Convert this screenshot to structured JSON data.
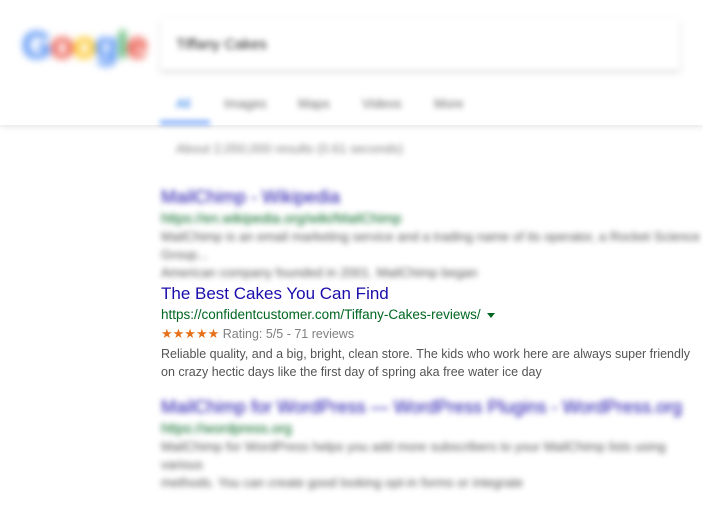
{
  "header": {
    "logo_letters": [
      "G",
      "o",
      "o",
      "g",
      "l",
      "e"
    ],
    "logo_colors": [
      "#4285f4",
      "#ea4335",
      "#fbbc05",
      "#4285f4",
      "#34a853",
      "#ea4335"
    ],
    "query": "Tiffany Cakes",
    "tabs": [
      "All",
      "Images",
      "Maps",
      "Videos",
      "More"
    ]
  },
  "stats": "About 2,050,000 results (0.61 seconds)",
  "results": [
    {
      "title": "MailChimp - Wikipedia",
      "url": "https://en.wikipedia.org/wiki/MailChimp",
      "snippet_1": "MailChimp is an email marketing service and a trading name of its operator, a Rocket Science Group...",
      "snippet_2": "American company founded in 2001. MailChimp began"
    },
    {
      "title": "The Best Cakes You Can Find",
      "url": "https://confidentcustomer.com/Tiffany-Cakes-reviews/",
      "stars": "★★★★★",
      "rating": "Rating: 5/5 - 71 reviews",
      "snippet_1": "Reliable quality, and a big, bright, clean store. The kids who work here are always super friendly",
      "snippet_2": "on crazy hectic days like the first day of spring aka free water ice day"
    },
    {
      "title": "MailChimp for WordPress — WordPress Plugins - WordPress.org",
      "url": "https://wordpress.org",
      "snippet_1": "MailChimp for WordPress helps you add more subscribers to your MailChimp lists using various",
      "snippet_2": "methods. You can create good looking opt-in forms or integrate"
    }
  ],
  "colors": {
    "link": "#1a0dab",
    "url": "#006621",
    "snippet": "#545454",
    "stars": "#e7711b",
    "tab_active": "#1a73e8"
  }
}
